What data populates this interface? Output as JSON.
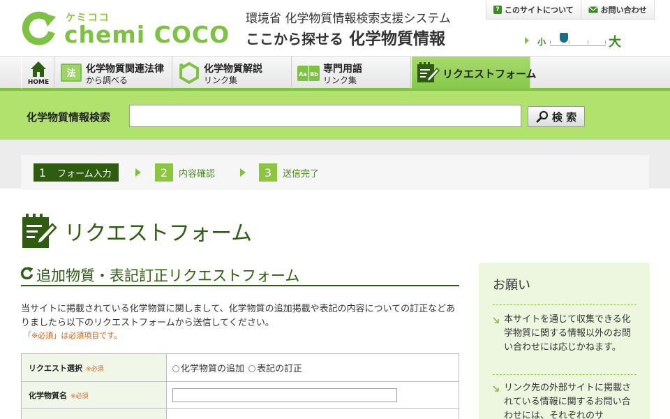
{
  "header": {
    "logo_kana": "ケミココ",
    "logo_text": "chemi COCO",
    "tagline_top": "環境省 化学物質情報検索支援システム",
    "tagline_bottom_small": "ここから探せる",
    "tagline_bottom_big": "化学物質情報",
    "utility_links": [
      {
        "icon": "question-icon",
        "label": "このサイトについて"
      },
      {
        "icon": "mail-icon",
        "label": "お問い合わせ"
      }
    ],
    "font_size": {
      "small": "小",
      "large": "大"
    }
  },
  "nav": {
    "home_label": "HOME",
    "items": [
      {
        "icon": "law-book-icon",
        "line1": "化学物質関連法律",
        "line2": "から調べる"
      },
      {
        "icon": "molecule-icon",
        "line1": "化学物質解説",
        "line2": "リンク集"
      },
      {
        "icon": "glossary-book-icon",
        "line1": "専門用語",
        "line2": "リンク集"
      },
      {
        "icon": "request-form-icon",
        "line1": "リクエストフォーム",
        "line2": ""
      }
    ]
  },
  "search": {
    "label": "化学物質情報検索",
    "value": "",
    "button_label": "検 索"
  },
  "steps": [
    {
      "num": "1",
      "label": "フォーム入力",
      "state": "current"
    },
    {
      "num": "2",
      "label": "内容確認",
      "state": "todo"
    },
    {
      "num": "3",
      "label": "送信完了",
      "state": "todo"
    }
  ],
  "page_title": "リクエストフォーム",
  "section_title": "追加物質・表記訂正リクエストフォーム",
  "intro_text": "当サイトに掲載されている化学物質に関しまして、化学物質の追加掲載や表記の内容についての訂正などありましたら以下のリクエストフォームから送信してください。",
  "required_note": "「※必須」は必須項目です。",
  "form": {
    "required_mark": "※必須",
    "rows": [
      {
        "label": "リクエスト選択",
        "required": true,
        "type": "radio",
        "options": [
          "化学物質の追加",
          "表記の訂正"
        ]
      },
      {
        "label": "化学物質名",
        "required": true,
        "type": "text",
        "value": ""
      },
      {
        "label": "",
        "required": false,
        "type": "text",
        "value": ""
      }
    ]
  },
  "sidebar": {
    "title": "お願い",
    "items": [
      "本サイトを通じて収集できる化学物質に関する情報以外のお問い合わせには応じかねます。",
      "リンク先の外部サイトに掲載されている情報に関するお問い合わせには、それぞれのサ"
    ]
  },
  "colors": {
    "brand_green": "#7dc242",
    "dark_green": "#2e5c11",
    "search_band": "#b0e26d",
    "required_orange": "#e55c0b",
    "side_bg": "#edf6df"
  }
}
